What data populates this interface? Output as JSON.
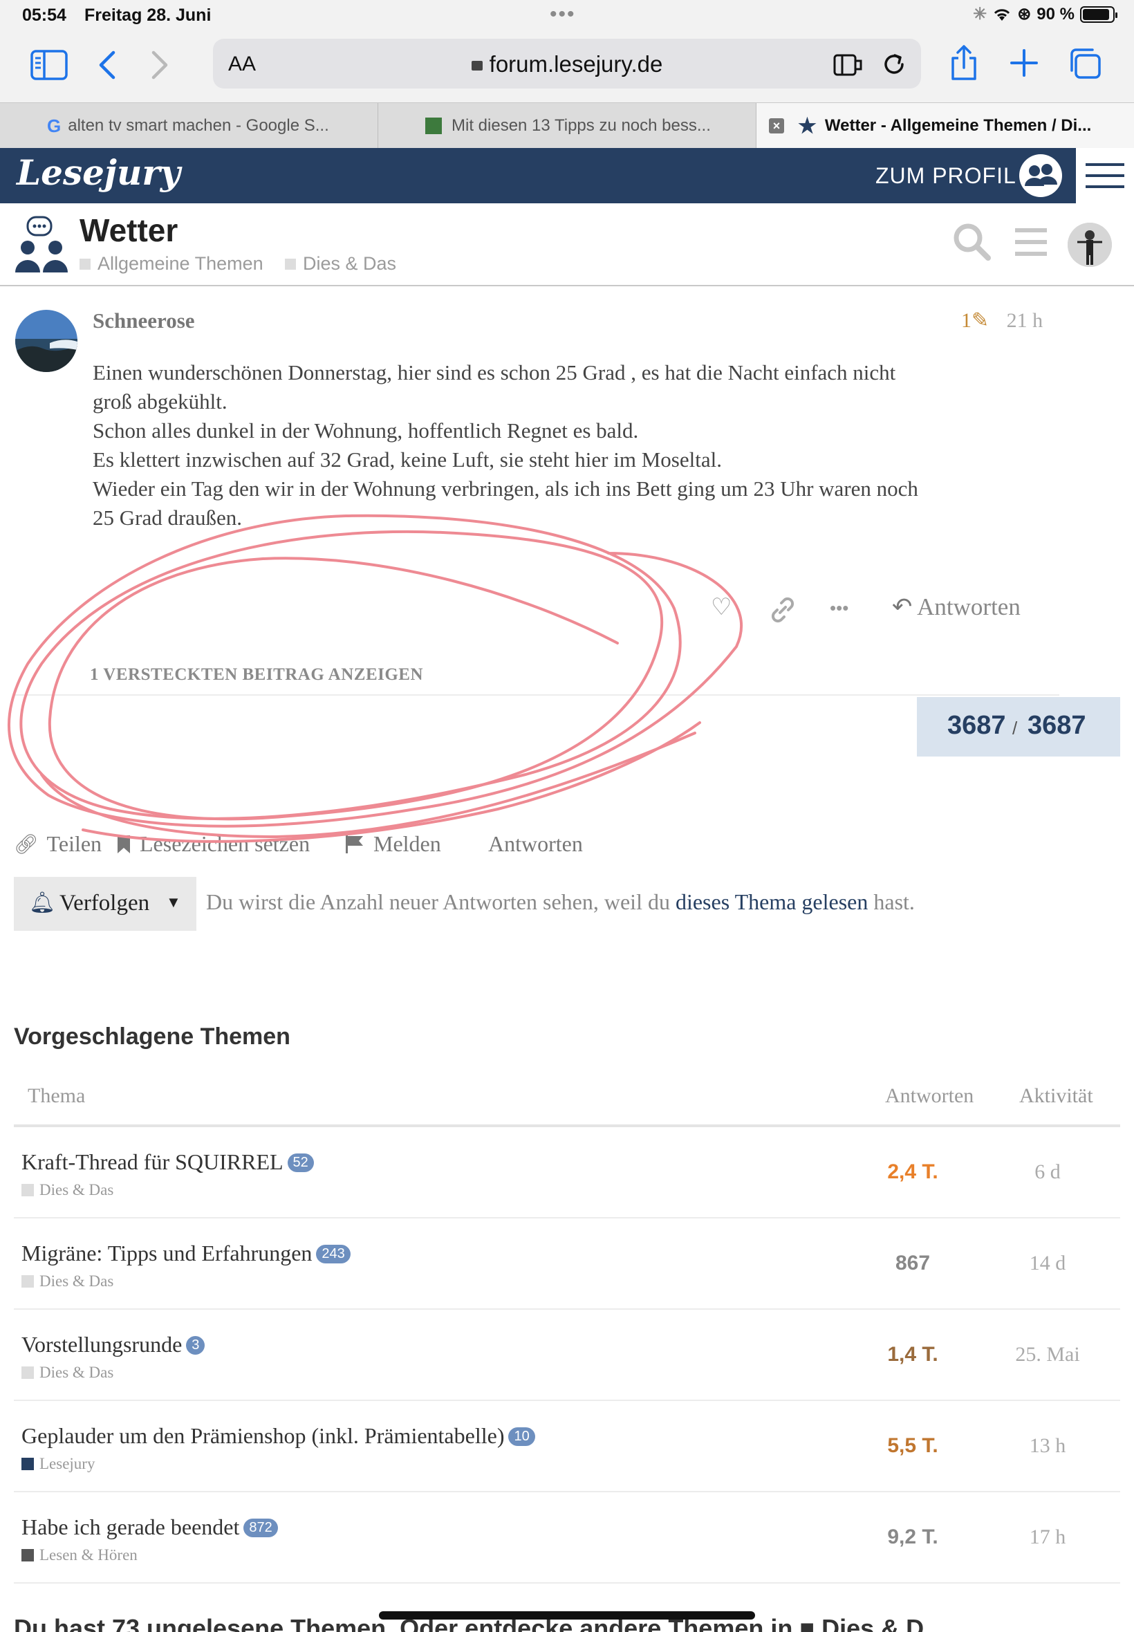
{
  "status_bar": {
    "time": "05:54",
    "date": "Freitag 28. Juni",
    "battery": "90 %"
  },
  "browser": {
    "aa_label": "AA",
    "url": "forum.lesejury.de",
    "tabs": [
      {
        "label": "alten tv smart machen - Google S..."
      },
      {
        "label": "Mit diesen 13 Tipps zu noch bess..."
      },
      {
        "label": "Wetter - Allgemeine Themen / Di..."
      }
    ]
  },
  "site_header": {
    "logo": "Lesejury",
    "profile_label": "ZUM PROFIL"
  },
  "topic": {
    "title": "Wetter",
    "categories": [
      "Allgemeine Themen",
      "Dies & Das"
    ]
  },
  "post": {
    "author": "Schneerose",
    "edits": "1",
    "age": "21 h",
    "lines": [
      "Einen wunderschönen Donnerstag, hier sind es schon 25 Grad , es hat die Nacht einfach nicht",
      "groß abgekühlt.",
      "Schon alles dunkel in der Wohnung, hoffentlich Regnet es bald.",
      "Es klettert inzwischen auf 32 Grad, keine Luft, sie steht hier im Moseltal.",
      "Wieder ein Tag den wir in der Wohnung verbringen, als ich ins Bett ging um 23 Uhr waren noch",
      "25 Grad draußen."
    ],
    "reply_label": "Antworten",
    "hidden_posts_label": "1 VERSTECKTEN BEITRAG ANZEIGEN"
  },
  "progress": {
    "current": "3687",
    "separator": "/",
    "total": "3687"
  },
  "footer_buttons": {
    "share": "Teilen",
    "bookmark": "Lesezeichen setzen",
    "flag": "Melden",
    "reply": "Antworten"
  },
  "notification": {
    "button_label": "Verfolgen",
    "text_before": "Du wirst die Anzahl neuer Antworten sehen, weil du ",
    "link": "dieses Thema gelesen",
    "text_after": " hast."
  },
  "suggested": {
    "heading": "Vorgeschlagene Themen",
    "columns": {
      "topic": "Thema",
      "replies": "Antworten",
      "activity": "Aktivität"
    },
    "rows": [
      {
        "title": "Kraft-Thread für SQUIRREL",
        "badge": "52",
        "category": "Dies & Das",
        "category_color": "#dddddd",
        "replies": "2,4 T.",
        "replies_color": "#e8802a",
        "activity": "6 d"
      },
      {
        "title": "Migräne: Tipps und Erfahrungen",
        "badge": "243",
        "category": "Dies & Das",
        "category_color": "#dddddd",
        "replies": "867",
        "replies_color": "#888888",
        "activity": "14 d"
      },
      {
        "title": "Vorstellungsrunde",
        "badge": "3",
        "category": "Dies & Das",
        "category_color": "#dddddd",
        "replies": "1,4 T.",
        "replies_color": "#9a6b3c",
        "activity": "25. Mai"
      },
      {
        "title": "Geplauder um den Prämienshop (inkl. Prämientabelle)",
        "badge": "10",
        "category": "Lesejury",
        "category_color": "#263f62",
        "replies": "5,5 T.",
        "replies_color": "#c0762f",
        "activity": "13 h"
      },
      {
        "title": "Habe ich gerade beendet",
        "badge": "872",
        "category": "Lesen & Hören",
        "category_color": "#555555",
        "replies": "9,2 T.",
        "replies_color": "#888888",
        "activity": "17 h"
      }
    ],
    "more_text": "Du hast 73 ungelesene Themen. Oder entdecke andere Themen in ■ Dies & D"
  },
  "colors": {
    "brand": "#263f62",
    "accent_link": "#1d73e8",
    "annotation": "#ee8a93"
  }
}
